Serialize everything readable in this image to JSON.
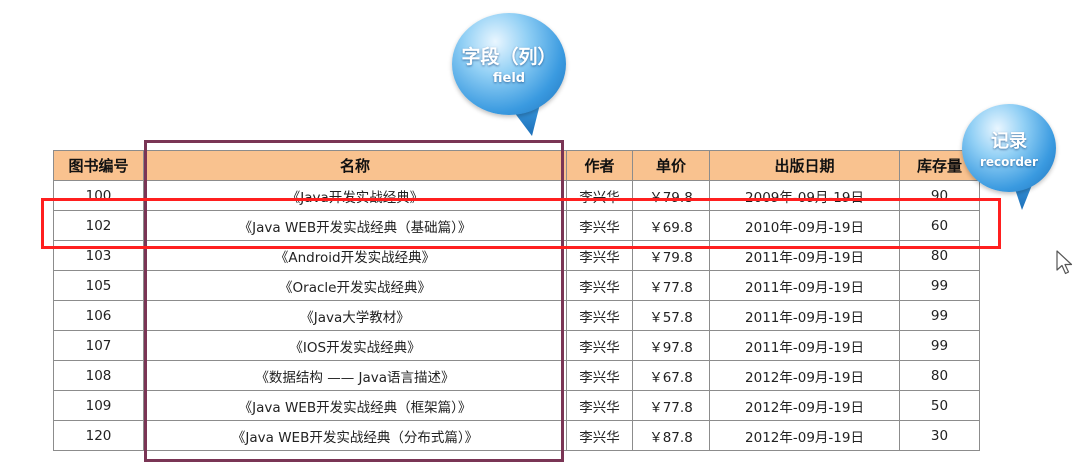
{
  "table": {
    "headers": [
      "图书编号",
      "名称",
      "作者",
      "单价",
      "出版日期",
      "库存量"
    ],
    "rows": [
      [
        "100",
        "《Java开发实战经典》",
        "李兴华",
        "￥79.8",
        "2009年-09月-19日",
        "90"
      ],
      [
        "102",
        "《Java WEB开发实战经典（基础篇）》",
        "李兴华",
        "￥69.8",
        "2010年-09月-19日",
        "60"
      ],
      [
        "103",
        "《Android开发实战经典》",
        "李兴华",
        "￥79.8",
        "2011年-09月-19日",
        "80"
      ],
      [
        "105",
        "《Oracle开发实战经典》",
        "李兴华",
        "￥77.8",
        "2011年-09月-19日",
        "99"
      ],
      [
        "106",
        "《Java大学教材》",
        "李兴华",
        "￥57.8",
        "2011年-09月-19日",
        "99"
      ],
      [
        "107",
        "《IOS开发实战经典》",
        "李兴华",
        "￥97.8",
        "2011年-09月-19日",
        "99"
      ],
      [
        "108",
        "《数据结构 —— Java语言描述》",
        "李兴华",
        "￥67.8",
        "2012年-09月-19日",
        "80"
      ],
      [
        "109",
        "《Java WEB开发实战经典（框架篇）》",
        "李兴华",
        "￥77.8",
        "2012年-09月-19日",
        "50"
      ],
      [
        "120",
        "《Java WEB开发实战经典（分布式篇）》",
        "李兴华",
        "￥87.8",
        "2012年-09月-19日",
        "30"
      ]
    ]
  },
  "callouts": {
    "field": {
      "main": "字段（列）",
      "sub": "field"
    },
    "record": {
      "main": "记录",
      "sub": "recorder"
    }
  },
  "highlight": {
    "column_index": 1,
    "row_index": 1,
    "column_color": "#7a3555",
    "row_color": "#ff1f1f"
  },
  "colors": {
    "header_bg": "#f9c28f",
    "bubble_blue": "#3a9ae0"
  },
  "icons": {
    "cursor": "mouse-pointer-icon"
  }
}
